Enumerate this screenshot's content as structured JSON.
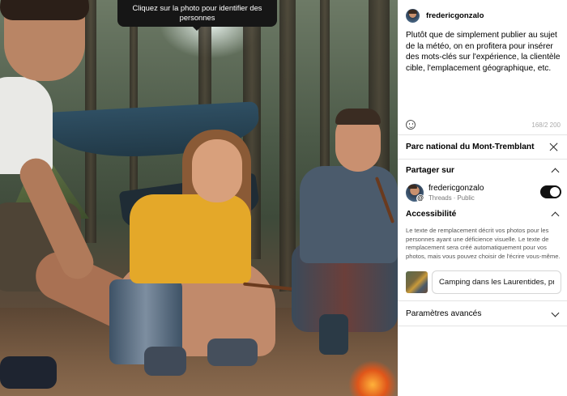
{
  "photo": {
    "tooltip": "Cliquez sur la photo pour identifier des personnes"
  },
  "post": {
    "author": "fredericgonzalo",
    "caption": "Plutôt que de simplement publier au sujet de la météo, on en profitera pour insérer des mots-clés sur l'expérience, la clientèle cible, l'emplacement géographique, etc.",
    "char_count": "168/2 200"
  },
  "location": {
    "name": "Parc national du Mont-Tremblant"
  },
  "share": {
    "title": "Partager sur",
    "account": "fredericgonzalo",
    "meta": "Threads · Public",
    "enabled": true
  },
  "accessibility": {
    "title": "Accessibilité",
    "description": "Le texte de remplacement décrit vos photos pour les personnes ayant une déficience visuelle. Le texte de remplacement sera créé automatiquement pour vos photos, mais vous pouvez choisir de l'écrire vous-même.",
    "alt_text_value": "Camping dans les Laurentides, près"
  },
  "advanced": {
    "title": "Paramètres avancés"
  },
  "icons": {
    "emoji": "emoji-smiley-icon",
    "close": "close-icon",
    "chevron_up": "chevron-up-icon",
    "chevron_down": "chevron-down-icon",
    "threads": "threads-icon"
  }
}
